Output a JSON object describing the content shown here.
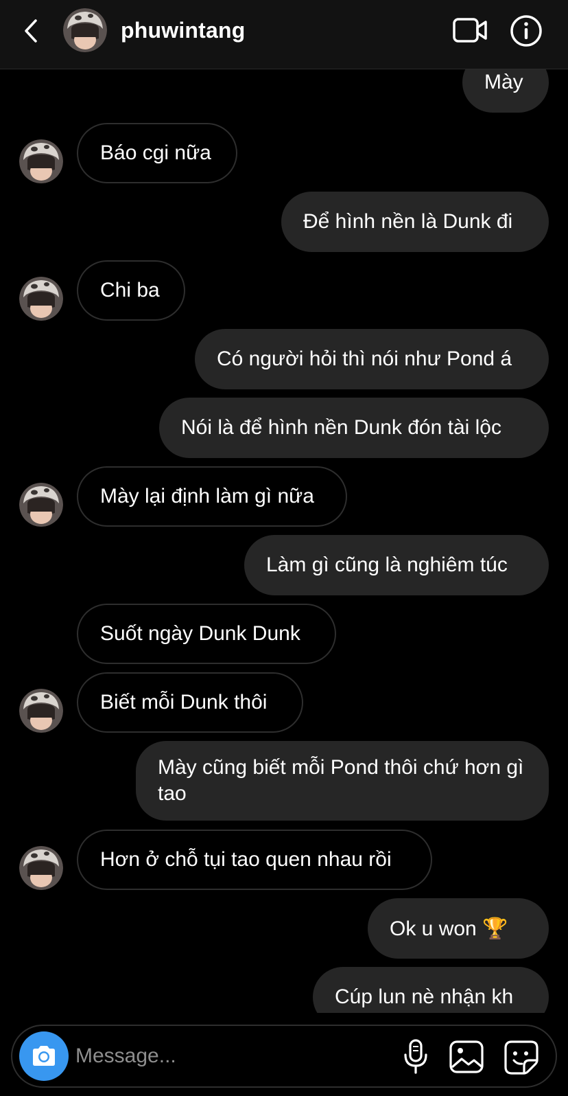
{
  "header": {
    "username": "phuwintang"
  },
  "messages": [
    {
      "from": "me",
      "text": "Mày"
    },
    {
      "from": "them",
      "text": "Báo cgi nữa"
    },
    {
      "from": "me",
      "text": "Để hình nền là Dunk đi"
    },
    {
      "from": "them",
      "text": "Chi ba"
    },
    {
      "from": "me",
      "text": "Có người hỏi thì nói như Pond á"
    },
    {
      "from": "me",
      "text": "Nói là để hình nền Dunk đón tài lộc"
    },
    {
      "from": "them",
      "text": "Mày lại định làm gì nữa"
    },
    {
      "from": "me",
      "text": "Làm gì cũng là nghiêm túc"
    },
    {
      "from": "them",
      "text": "Suốt ngày Dunk Dunk"
    },
    {
      "from": "them",
      "text": "Biết mỗi Dunk thôi"
    },
    {
      "from": "me",
      "text": "Mày cũng biết mỗi Pond thôi chứ hơn gì tao"
    },
    {
      "from": "them",
      "text": "Hơn ở chỗ tụi tao quen nhau rồi"
    },
    {
      "from": "me",
      "text": "Ok u won 🏆"
    },
    {
      "from": "me",
      "text": "Cúp lun nè nhận kh"
    }
  ],
  "composer": {
    "placeholder": "Message..."
  },
  "colors": {
    "background": "#000000",
    "header_bg": "#121212",
    "outgoing_bubble": "#262626",
    "incoming_border": "#2e2e2e",
    "camera_button": "#3897f0"
  },
  "icons": [
    "back-icon",
    "video-call-icon",
    "info-icon",
    "camera-icon",
    "microphone-icon",
    "gallery-icon",
    "sticker-icon"
  ]
}
